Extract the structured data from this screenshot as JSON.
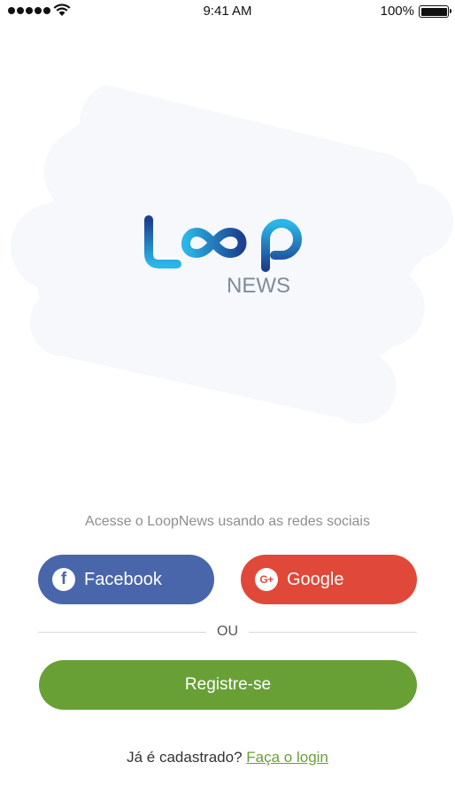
{
  "status_bar": {
    "time": "9:41 AM",
    "battery": "100%"
  },
  "logo": {
    "word": "LOOP",
    "sub": "NEWS",
    "colors": {
      "light_blue": "#2bb6e8",
      "dark_blue": "#1c3f8f",
      "gray": "#7f8c9b"
    }
  },
  "social": {
    "subtitle": "Acesse o LoopNews usando as redes sociais",
    "facebook_label": "Facebook",
    "google_label": "Google",
    "facebook_icon": "f",
    "google_icon": "G+"
  },
  "divider": {
    "label": "OU"
  },
  "register": {
    "label": "Registre-se"
  },
  "login": {
    "prompt": "Já é cadastrado?",
    "link": "Faça o login"
  },
  "colors": {
    "facebook": "#4a66ab",
    "google": "#e0493a",
    "green": "#68a036",
    "hero_bg": "#f6f8fb"
  }
}
